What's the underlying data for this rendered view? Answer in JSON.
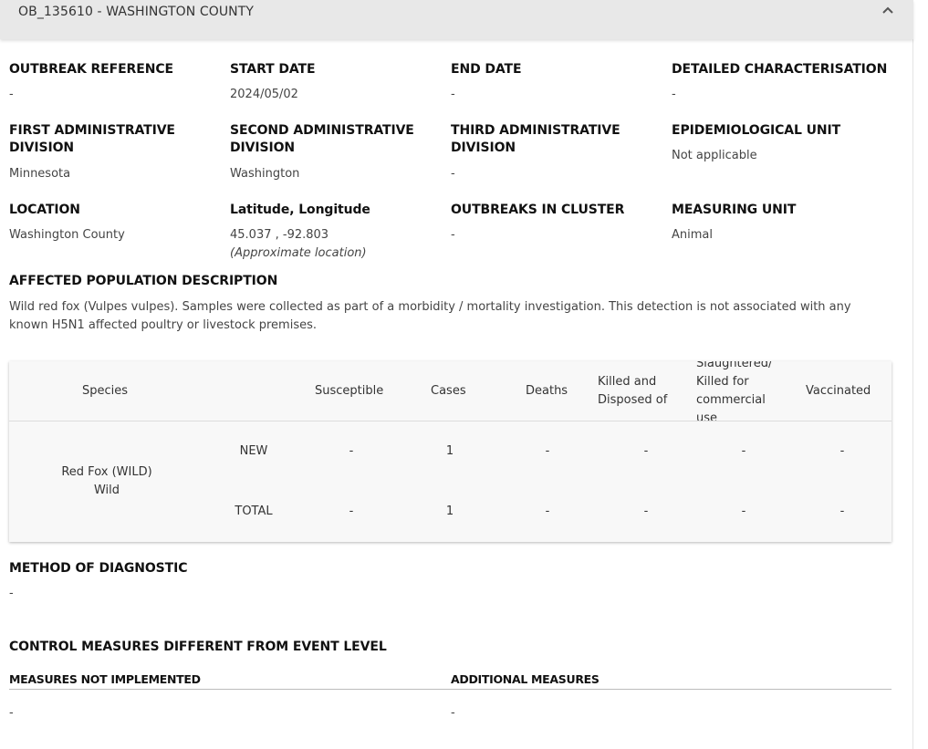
{
  "header": {
    "title": "OB_135610 - WASHINGTON COUNTY"
  },
  "fields": {
    "outbreak_reference": {
      "label": "OUTBREAK REFERENCE",
      "value": "-"
    },
    "start_date": {
      "label": "START DATE",
      "value": "2024/05/02"
    },
    "end_date": {
      "label": "END DATE",
      "value": "-"
    },
    "detailed_characterisation": {
      "label": "DETAILED CHARACTERISATION",
      "value": "-"
    },
    "first_admin_division": {
      "label_line1": "FIRST ADMINISTRATIVE",
      "label_line2": "DIVISION",
      "value": "Minnesota"
    },
    "second_admin_division": {
      "label_line1": "SECOND ADMINISTRATIVE",
      "label_line2": "DIVISION",
      "value": "Washington"
    },
    "third_admin_division": {
      "label_line1": "THIRD ADMINISTRATIVE",
      "label_line2": "DIVISION",
      "value": "-"
    },
    "epidemiological_unit": {
      "label": "EPIDEMIOLOGICAL UNIT",
      "value": "Not applicable"
    },
    "location": {
      "label": "LOCATION",
      "value": "Washington County"
    },
    "lat_long": {
      "label": "Latitude, Longitude",
      "value": "45.037 , -92.803",
      "note": "(Approximate location)"
    },
    "outbreaks_in_cluster": {
      "label": "OUTBREAKS IN CLUSTER",
      "value": "-"
    },
    "measuring_unit": {
      "label": "MEASURING UNIT",
      "value": "Animal"
    }
  },
  "affected_population": {
    "label": "AFFECTED POPULATION DESCRIPTION",
    "text": "Wild red fox (Vulpes vulpes). Samples were collected as part of a morbidity / mortality investigation. This detection is not associated with any known H5N1 affected poultry or livestock premises."
  },
  "species_table": {
    "headers": {
      "species": "Species",
      "susceptible": "Susceptible",
      "cases": "Cases",
      "deaths": "Deaths",
      "killed_line1": "Killed and",
      "killed_line2": "Disposed of",
      "slaughtered_line1": "Slaughtered/",
      "slaughtered_line2": "Killed for",
      "slaughtered_line3": "commercial",
      "slaughtered_line4": "use",
      "vaccinated": "Vaccinated"
    },
    "species_name_line1": "Red Fox (WILD)",
    "species_name_line2": "Wild",
    "rows": [
      {
        "type": "NEW",
        "susceptible": "-",
        "cases": "1",
        "deaths": "-",
        "killed": "-",
        "slaughtered": "-",
        "vaccinated": "-"
      },
      {
        "type": "TOTAL",
        "susceptible": "-",
        "cases": "1",
        "deaths": "-",
        "killed": "-",
        "slaughtered": "-",
        "vaccinated": "-"
      }
    ]
  },
  "method_of_diagnostic": {
    "label": "METHOD OF DIAGNOSTIC",
    "value": "-"
  },
  "control_measures": {
    "label": "CONTROL MEASURES DIFFERENT FROM EVENT LEVEL",
    "not_implemented": {
      "label": "MEASURES NOT IMPLEMENTED",
      "value": "-"
    },
    "additional": {
      "label": "ADDITIONAL MEASURES",
      "value": "-"
    }
  }
}
